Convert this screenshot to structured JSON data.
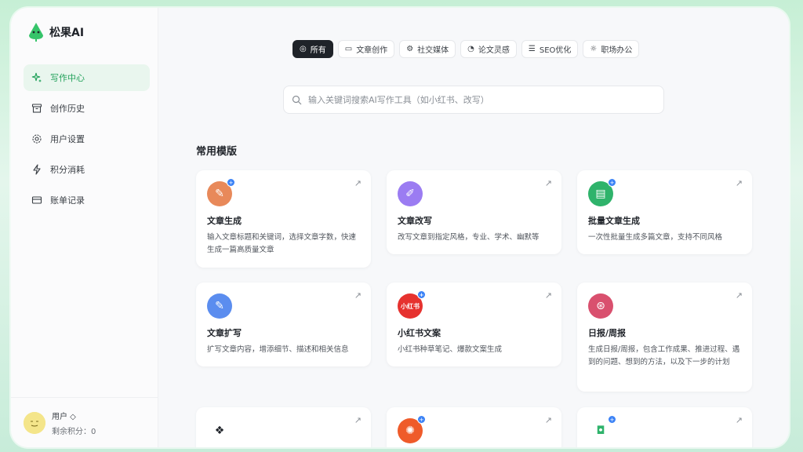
{
  "brand": {
    "name": "松果AI",
    "logo": "pinecone-logo"
  },
  "sidebar": {
    "items": [
      {
        "label": "写作中心",
        "icon": "sparkle-icon",
        "active": true
      },
      {
        "label": "创作历史",
        "icon": "archive-icon",
        "active": false
      },
      {
        "label": "用户设置",
        "icon": "gear-icon",
        "active": false
      },
      {
        "label": "积分消耗",
        "icon": "lightning-icon",
        "active": false
      },
      {
        "label": "账单记录",
        "icon": "card-icon",
        "active": false
      }
    ]
  },
  "user": {
    "name": "用户 ◇",
    "points_label": "剩余积分：0",
    "avatar": "smile-avatar"
  },
  "tabs": [
    {
      "label": "所有",
      "icon": "target-icon",
      "active": true
    },
    {
      "label": "文章创作",
      "icon": "folder-icon",
      "active": false
    },
    {
      "label": "社交媒体",
      "icon": "gear-icon",
      "active": false
    },
    {
      "label": "论文灵感",
      "icon": "circles-icon",
      "active": false
    },
    {
      "label": "SEO优化",
      "icon": "list-icon",
      "active": false
    },
    {
      "label": "职场办公",
      "icon": "sun-icon",
      "active": false
    }
  ],
  "search": {
    "placeholder": "输入关键词搜索AI写作工具（如小红书、改写）"
  },
  "section_title": "常用模版",
  "cards": [
    {
      "title": "文章生成",
      "desc": "输入文章标题和关键词，选择文章字数，快速生成一篇高质量文章",
      "color": "#e8895a",
      "glyph": "✎",
      "badge": true
    },
    {
      "title": "文章改写",
      "desc": "改写文章到指定风格，专业、学术、幽默等",
      "color": "#9b7cf2",
      "glyph": "✐",
      "badge": false
    },
    {
      "title": "批量文章生成",
      "desc": "一次性批量生成多篇文章，支持不同风格",
      "color": "#2fb36b",
      "glyph": "▤",
      "badge": true
    },
    {
      "title": "文章扩写",
      "desc": "扩写文章内容，增添细节、描述和相关信息",
      "color": "#5b8def",
      "glyph": "✎",
      "badge": false
    },
    {
      "title": "小红书文案",
      "desc": "小红书种草笔记、爆款文案生成",
      "color": "#e6322f",
      "glyph": "小红书",
      "badge": true
    },
    {
      "title": "日报/周报",
      "desc": "生成日报/周报，包含工作成果、推进过程、遇到的问题、想到的方法，以及下一步的计划",
      "color": "#d9506e",
      "glyph": "⊛",
      "badge": false
    },
    {
      "title": "",
      "desc": "",
      "color": "#ffffff",
      "glyph": "❖",
      "badge": false
    },
    {
      "title": "",
      "desc": "",
      "color": "#ef5b2a",
      "glyph": "✺",
      "badge": true
    },
    {
      "title": "",
      "desc": "",
      "color": "#ffffff",
      "glyph": "◘",
      "badge": true
    }
  ]
}
